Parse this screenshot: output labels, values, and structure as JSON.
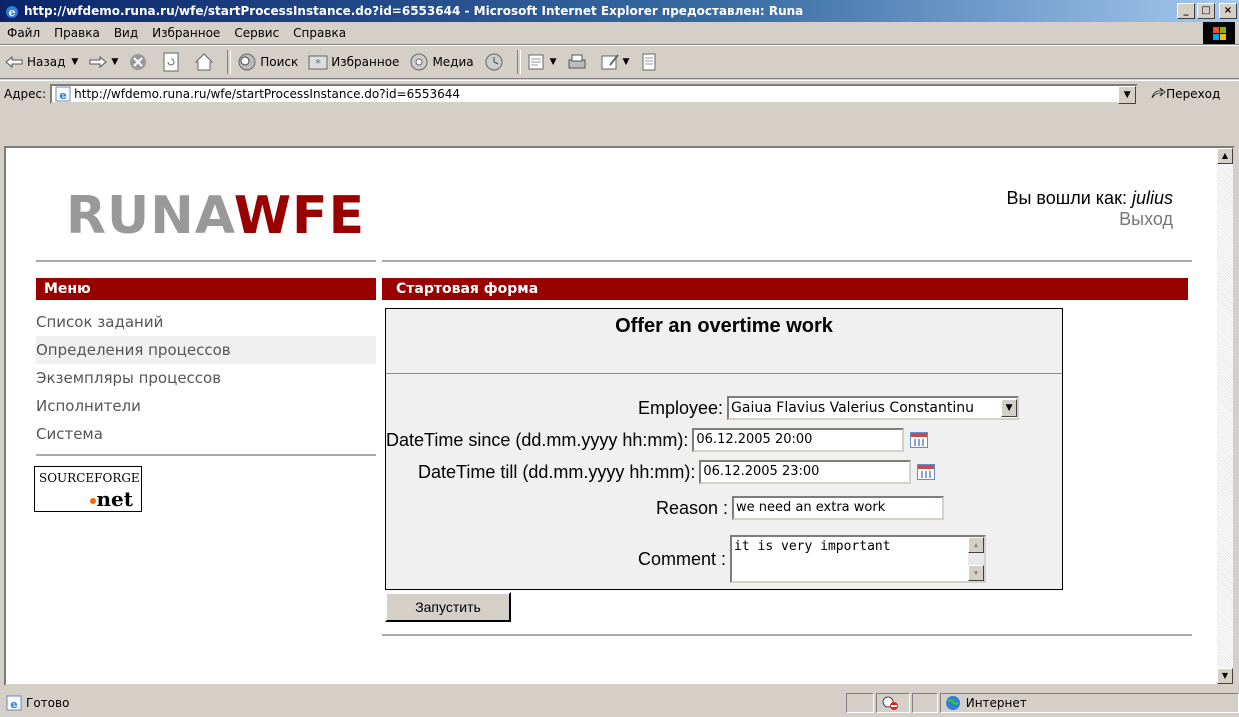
{
  "window": {
    "title": "http://wfdemo.runa.ru/wfe/startProcessInstance.do?id=6553644 - Microsoft Internet Explorer предоставлен: Runa"
  },
  "menubar": {
    "items": [
      "Файл",
      "Правка",
      "Вид",
      "Избранное",
      "Сервис",
      "Справка"
    ]
  },
  "toolbar": {
    "back_label": "Назад",
    "search_label": "Поиск",
    "favorites_label": "Избранное",
    "media_label": "Медиа"
  },
  "addressbar": {
    "label": "Адрес:",
    "url": "http://wfdemo.runa.ru/wfe/startProcessInstance.do?id=6553644",
    "go_label": "Переход"
  },
  "page": {
    "logo_left": "RUNA",
    "logo_right": "WFE",
    "user_prefix": "Вы вошли как:",
    "user_name": "julius",
    "logout": "Выход",
    "menu_title": "Меню",
    "menu_items": [
      "Список заданий",
      "Определения процессов",
      "Экземпляры процессов",
      "Исполнители",
      "Система"
    ],
    "sourceforge_top": "SOURCEFORGE",
    "sourceforge_bottom": "net",
    "form_header": "Стартовая форма",
    "form": {
      "title": "Offer an overtime work",
      "employee_label": "Employee:",
      "employee_value": "Gaiua Flavius Valerius Constantinu",
      "since_label": "DateTime since (dd.mm.yyyy hh:mm):",
      "since_value": "06.12.2005 20:00",
      "till_label": "DateTime till (dd.mm.yyyy hh:mm):",
      "till_value": "06.12.2005 23:00",
      "reason_label": "Reason :",
      "reason_value": "we need an extra work",
      "comment_label": "Comment :",
      "comment_value": "it is very important",
      "submit_label": "Запустить"
    }
  },
  "statusbar": {
    "status": "Готово",
    "zone": "Интернет"
  }
}
